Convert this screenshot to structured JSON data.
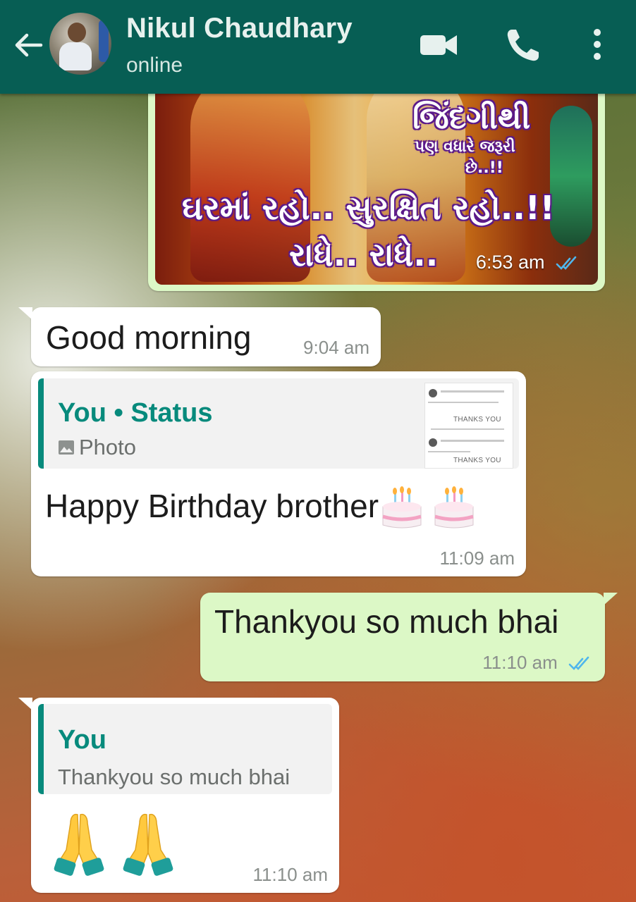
{
  "header": {
    "contact_name": "Nikul Chaudhary",
    "status": "online",
    "icons": [
      "back-arrow-icon",
      "video-call-icon",
      "phone-icon",
      "more-options-icon"
    ],
    "color": "#075e54"
  },
  "messages": [
    {
      "type": "image",
      "direction": "outgoing",
      "image_text_lines": [
        "જિંદગીથી",
        "પણ વધારે જરૂરી",
        "છે..!!",
        "ઘરમાં રહો.. સુરક્ષિત રહો..!!",
        "રાધે.. રાધે.."
      ],
      "time": "6:53 am",
      "status": "read"
    },
    {
      "type": "text",
      "direction": "incoming",
      "text": "Good morning",
      "time": "9:04 am"
    },
    {
      "type": "reply",
      "direction": "incoming",
      "quote_author": "You • Status",
      "quote_subtitle": "Photo",
      "quote_thumb_text": "THANKS YOU",
      "text": "Happy Birthday brother",
      "emoji": "birthday-cake-emoji x2",
      "time": "11:09 am"
    },
    {
      "type": "text",
      "direction": "outgoing",
      "text": "Thankyou so much bhai",
      "time": "11:10 am",
      "status": "read"
    },
    {
      "type": "reply",
      "direction": "incoming",
      "quote_author": "You",
      "quote_subtitle": "Thankyou so much bhai",
      "emoji": "folded-hands-emoji x2",
      "time": "11:10 am"
    }
  ],
  "colors": {
    "outgoing_bubble": "#dcf8c6",
    "incoming_bubble": "#ffffff",
    "quote_accent": "#078a7c",
    "read_ticks": "#4fb6ec"
  }
}
